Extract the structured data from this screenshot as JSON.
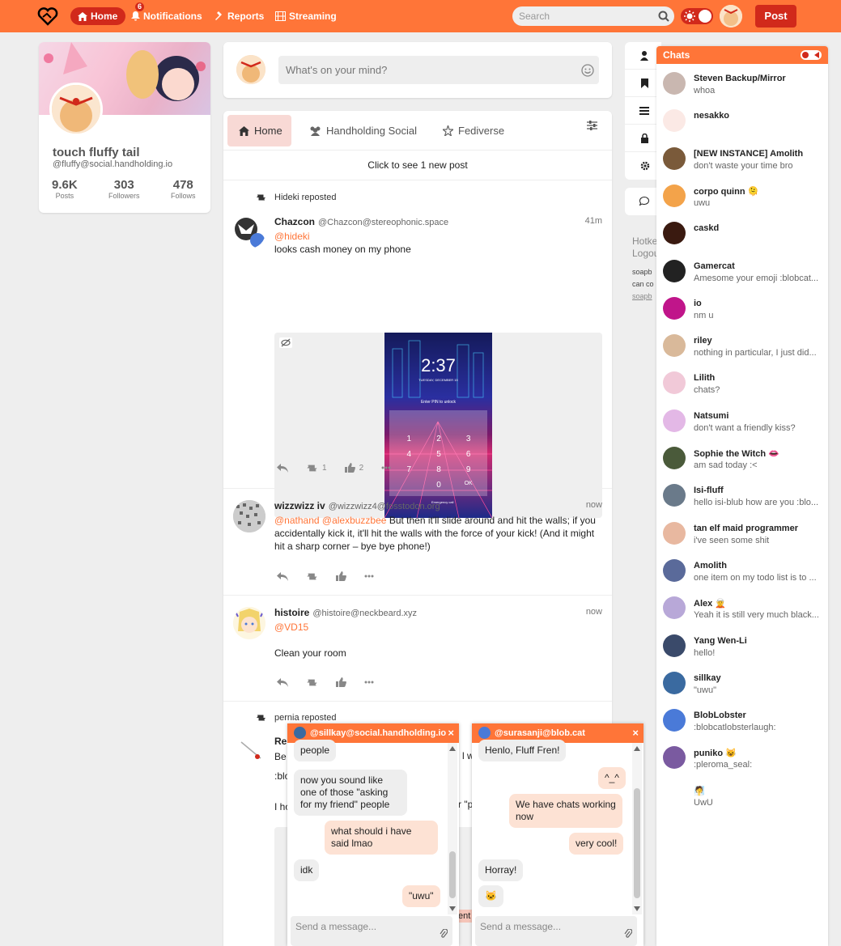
{
  "nav": {
    "home": "Home",
    "notifications": "Notifications",
    "notifications_count": "6",
    "reports": "Reports",
    "streaming": "Streaming",
    "search_placeholder": "Search",
    "post": "Post"
  },
  "profile": {
    "name": "touch fluffy tail",
    "handle": "@fluffy@social.handholding.io",
    "posts": "9.6K",
    "posts_label": "Posts",
    "followers": "303",
    "followers_label": "Followers",
    "follows": "478",
    "follows_label": "Follows"
  },
  "composer": {
    "placeholder": "What's on your mind?"
  },
  "timeline": {
    "tabs": [
      "Home",
      "Handholding Social",
      "Fediverse"
    ],
    "new_posts": "Click to see 1 new post",
    "posts": [
      {
        "reposted_by": "Hideki reposted",
        "name": "Chazcon",
        "handle": "@Chazcon@stereophonic.space",
        "time": "41m",
        "mention": "@hideki",
        "text": "looks cash money on my phone",
        "phone_time": "2:37",
        "phone_date": "TUESDAY, DECEMBER 15",
        "phone_prompt": "Enter PIN to unlock",
        "keys": [
          "1",
          "2",
          "3",
          "4",
          "5",
          "6",
          "7",
          "8",
          "9",
          "0",
          "OK"
        ],
        "emergency": "Emergency call",
        "reposts": "1",
        "likes": "2"
      },
      {
        "name": "wizzwizz iv",
        "handle": "@wizzwizz4@fosstodon.org",
        "time": "now",
        "mention": "@nathand @alexbuzzbee",
        "text": "But then it'll slide around and hit the walls; if you accidentally kick it, it'll hit the walls with the force of your kick! (And it might hit a sharp corner – bye bye phone!)"
      },
      {
        "name": "histoire",
        "handle": "@histoire@neckbeard.xyz",
        "time": "now",
        "mention": "@VD15",
        "text": "Clean your room"
      },
      {
        "reposted_by": "pernia reposted",
        "name": "Re",
        "text_a": "Be",
        "text_b": ":blo",
        "text_c": "I ho",
        "frag_1": "l wa",
        "frag_2": "r \"p",
        "frag_3": "tent"
      }
    ]
  },
  "side": {
    "hotkeys": "Hotke",
    "logout": "Logou",
    "small1": "soapb",
    "small2": "can co",
    "small3": "soapb"
  },
  "chats": {
    "title": "Chats",
    "items": [
      {
        "name": "Steven Backup/Mirror",
        "msg": "whoa",
        "color": "#c9b7b0"
      },
      {
        "name": "nesakko",
        "msg": "",
        "color": "#fbe9e5"
      },
      {
        "name": "[NEW INSTANCE] Amolith",
        "msg": "don't waste your time bro",
        "color": "#7a5a3a"
      },
      {
        "name": "corpo quinn 🫠",
        "msg": "uwu",
        "color": "#f3a34a"
      },
      {
        "name": "caskd",
        "msg": "",
        "color": "#3a1a10"
      },
      {
        "name": "Gamercat",
        "msg": "Amesome your emoji :blobcat...",
        "color": "#222"
      },
      {
        "name": "io",
        "msg": "nm u",
        "color": "#c0158a"
      },
      {
        "name": "riley",
        "msg": "nothing in particular, I just did...",
        "color": "#d9b99a"
      },
      {
        "name": "Lilith",
        "msg": "chats?",
        "color": "#f1c9d8"
      },
      {
        "name": "Natsumi",
        "msg": "don't want a friendly kiss?",
        "color": "#e3b8e6"
      },
      {
        "name": "Sophie the Witch 👄",
        "msg": "am sad today :<",
        "color": "#4a5a3a"
      },
      {
        "name": "Isi-fluff",
        "msg": "hello isi-blub how are you :blo...",
        "color": "#6a7a8a"
      },
      {
        "name": "tan elf maid programmer",
        "msg": "i've seen some shit",
        "color": "#e8b8a0"
      },
      {
        "name": "Amolith",
        "msg": "one item on my todo list is to ...",
        "color": "#5a6a9a"
      },
      {
        "name": "Alex 🧝",
        "msg": "Yeah it is still very much black...",
        "color": "#b8a8d8"
      },
      {
        "name": "Yang Wen-Li",
        "msg": "hello!",
        "color": "#3a4a6a"
      },
      {
        "name": "sillkay",
        "msg": "\"uwu\"",
        "color": "#3a6aa0"
      },
      {
        "name": "BlobLobster",
        "msg": ":blobcatlobsterlaugh:",
        "color": "#4a7ad8"
      },
      {
        "name": "puniko 😺",
        "msg": ":pleroma_seal:",
        "color": "#7a5aa0"
      },
      {
        "name": "🧖",
        "msg": "UwU",
        "color": "#ffffff"
      }
    ]
  },
  "chat_windows": [
    {
      "title": "@sillkay@social.handholding.io",
      "messages": [
        {
          "dir": "in",
          "text": "people"
        },
        {
          "dir": "in",
          "text": "now you sound like one of those \"asking for my friend\" people"
        },
        {
          "dir": "out",
          "text": "what should i have said lmao"
        },
        {
          "dir": "in",
          "text": "idk"
        },
        {
          "dir": "out",
          "text": "\"uwu\""
        }
      ],
      "placeholder": "Send a message..."
    },
    {
      "title": "@surasanji@blob.cat",
      "messages": [
        {
          "dir": "in",
          "text": "Henlo, Fluff Fren!"
        },
        {
          "dir": "out",
          "text": "^_^"
        },
        {
          "dir": "out",
          "text": "We have chats working now"
        },
        {
          "dir": "out",
          "text": "very cool!"
        },
        {
          "dir": "in",
          "text": "Horray!"
        },
        {
          "dir": "in",
          "text": "🐱"
        }
      ],
      "placeholder": "Send a message..."
    }
  ],
  "colors": {
    "accent": "#ff7538",
    "accent_dark": "#d1291b",
    "link": "#ff7538"
  }
}
